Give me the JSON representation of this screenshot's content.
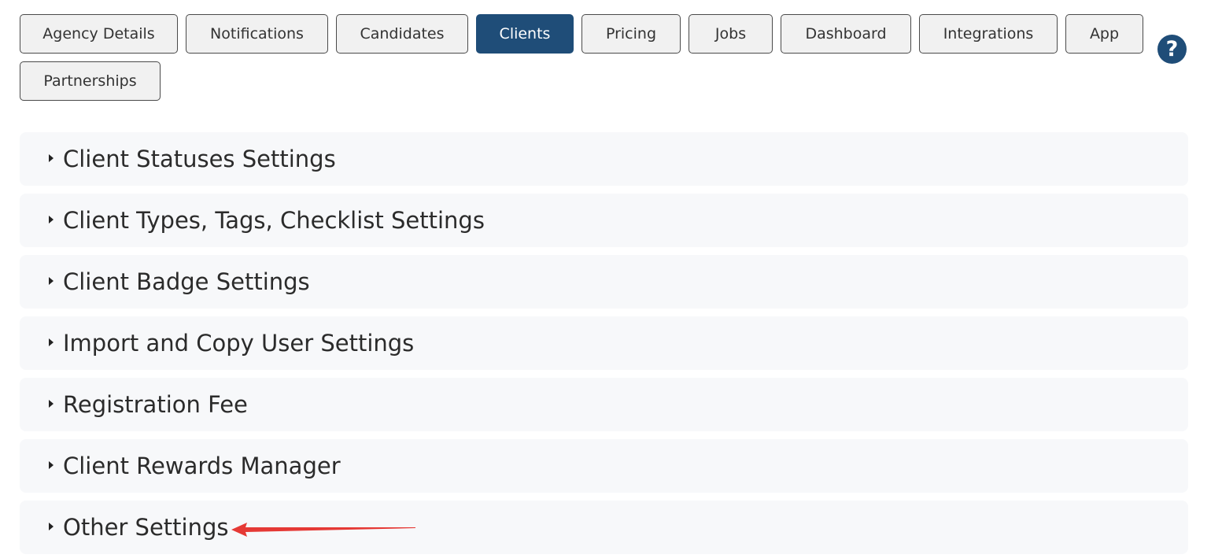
{
  "tabs": [
    {
      "label": "Agency Details"
    },
    {
      "label": "Notifications"
    },
    {
      "label": "Candidates"
    },
    {
      "label": "Clients",
      "active": true
    },
    {
      "label": "Pricing"
    },
    {
      "label": "Jobs"
    },
    {
      "label": "Dashboard"
    },
    {
      "label": "Integrations"
    },
    {
      "label": "App"
    },
    {
      "label": "Partnerships"
    }
  ],
  "help": {
    "label": "?",
    "icon": "question-circle-icon"
  },
  "sections": [
    {
      "label": "Client Statuses Settings"
    },
    {
      "label": "Client Types, Tags, Checklist Settings"
    },
    {
      "label": "Client Badge Settings"
    },
    {
      "label": "Import and Copy User Settings"
    },
    {
      "label": "Registration Fee"
    },
    {
      "label": "Client Rewards Manager"
    },
    {
      "label": "Other Settings"
    }
  ],
  "colors": {
    "accent": "#1f4d78",
    "annotation_arrow": "#e53935"
  }
}
